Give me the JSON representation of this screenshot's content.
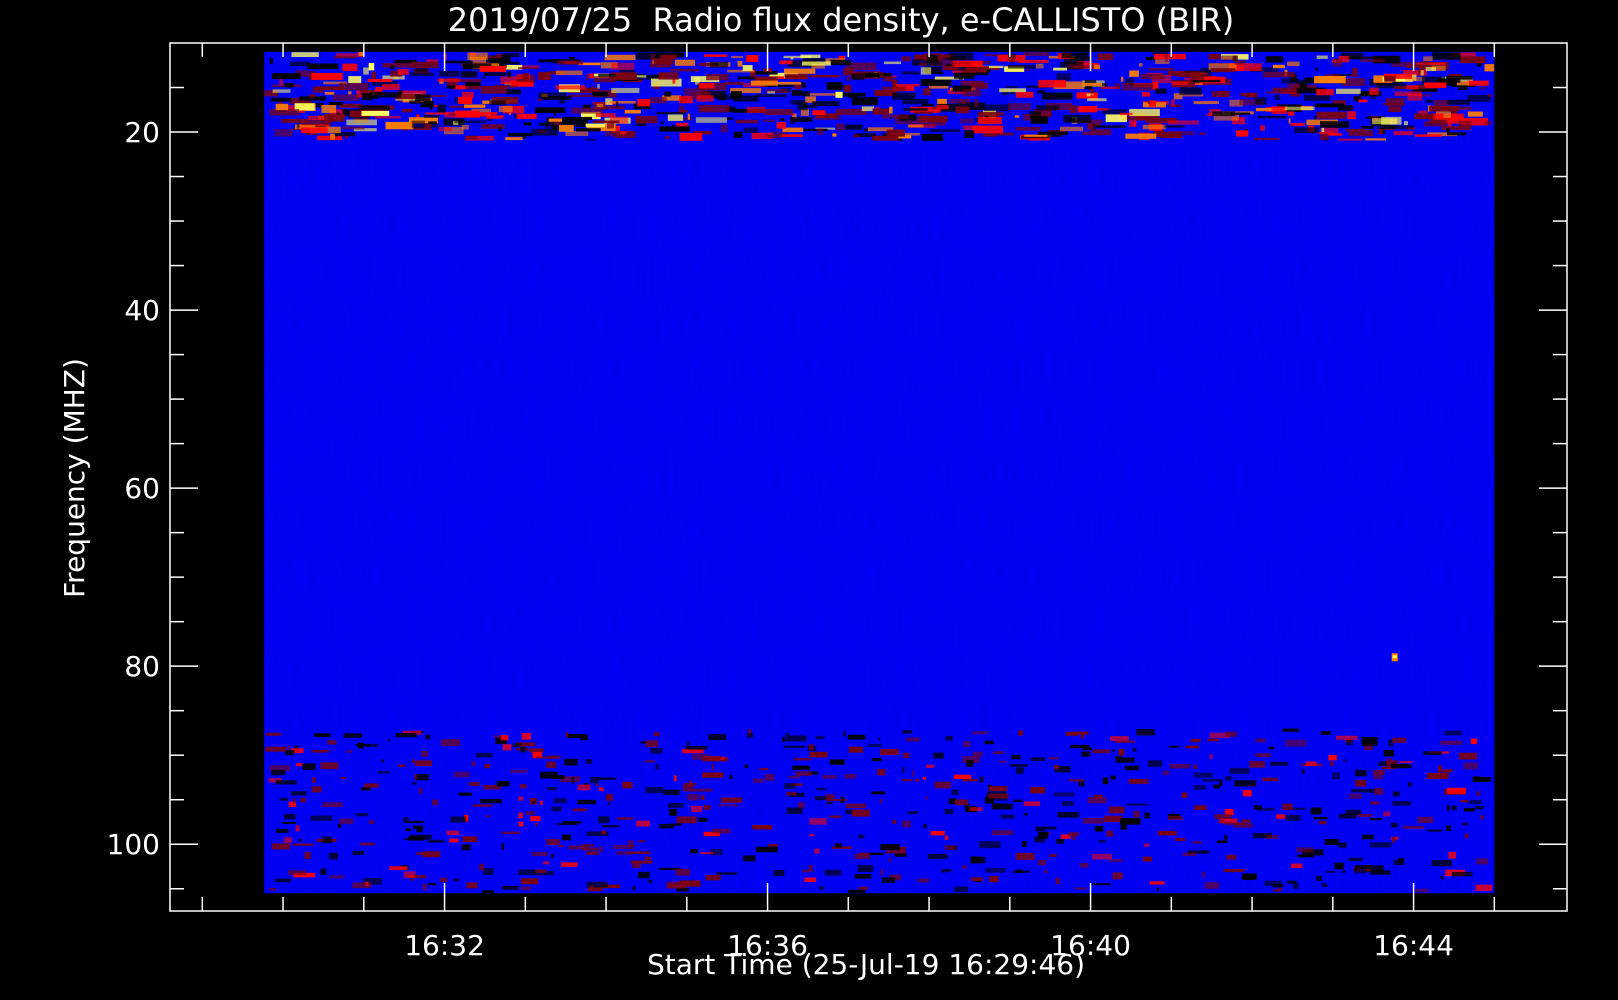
{
  "chart_data": {
    "type": "heatmap",
    "title": "2019/07/25  Radio flux density, e-CALLISTO (BIR)",
    "xlabel": "Start Time (25-Jul-19 16:29:46)",
    "ylabel": "Frequency (MHZ)",
    "x_start": "16:29:46",
    "x_end": "16:45:00",
    "xlim": [
      "16:28:36",
      "16:45:54"
    ],
    "ylim": [
      107.5,
      10
    ],
    "y_inverted": true,
    "data_y_range": [
      11,
      105.5
    ],
    "x_ticks": [
      "16:32",
      "16:36",
      "16:40",
      "16:44"
    ],
    "y_ticks": [
      20,
      40,
      60,
      80,
      100
    ],
    "colormap": [
      "#000000",
      "#0000ff",
      "#7a0010",
      "#ff0000",
      "#ff8000",
      "#ffff60"
    ],
    "background_color": "#000000",
    "axis_color": "#ffffff",
    "features": [
      {
        "kind": "intense band (RFI)",
        "freq_mhz": [
          11,
          21
        ],
        "level": "high"
      },
      {
        "kind": "moderate band",
        "freq_mhz": [
          87,
          105.5
        ],
        "level": "medium"
      },
      {
        "kind": "point",
        "time": "16:43:46",
        "freq_mhz": 79,
        "level": "high"
      }
    ]
  }
}
